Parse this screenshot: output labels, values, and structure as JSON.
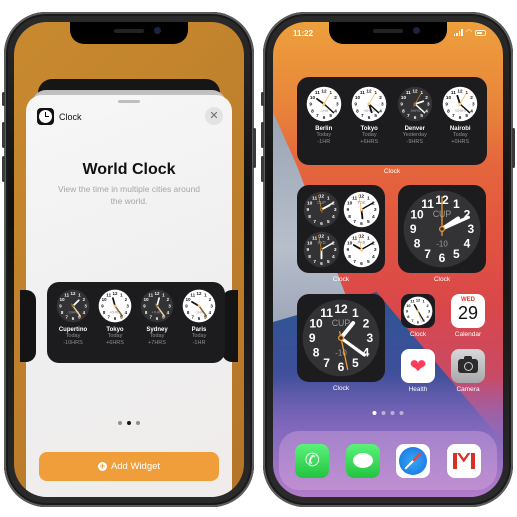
{
  "left_phone": {
    "sheet": {
      "app_name": "Clock",
      "close_icon": "✕",
      "title": "World Clock",
      "description": "View the time in multiple cities around the world.",
      "page_dots": {
        "count": 3,
        "active": 1
      },
      "add_button_label": "Add Widget",
      "add_button_icon": "+",
      "accent_color": "#f09e3a"
    },
    "preview_widget": {
      "cities": [
        {
          "name": "Cupertino",
          "day": "Today",
          "offset": "-10HRS",
          "face": "dark",
          "hour": 1.5,
          "minute": 24,
          "second": 24
        },
        {
          "name": "Tokyo",
          "day": "Today",
          "offset": "+6HRS",
          "face": "light",
          "hour": 11.5,
          "minute": 24,
          "second": 24
        },
        {
          "name": "Sydney",
          "day": "Today",
          "offset": "+7HRS",
          "face": "dark",
          "hour": 12.5,
          "minute": 24,
          "second": 24
        },
        {
          "name": "Paris",
          "day": "Today",
          "offset": "-1HR",
          "face": "light",
          "hour": 10,
          "minute": 24,
          "second": 24
        }
      ]
    }
  },
  "right_phone": {
    "status_bar": {
      "time": "11:22"
    },
    "world_widget": {
      "label": "Clock",
      "cities": [
        {
          "name": "Berlin",
          "day": "Today",
          "offset": "-1HR",
          "face": "light",
          "hour": 10.2,
          "minute": 22,
          "second": 5
        },
        {
          "name": "Tokyo",
          "day": "Today",
          "offset": "+6HRS",
          "face": "light",
          "hour": 5.4,
          "minute": 22,
          "second": 5
        },
        {
          "name": "Denver",
          "day": "Yesterday",
          "offset": "-9HRS",
          "face": "dark",
          "hour": 2.4,
          "minute": 22,
          "second": 5
        },
        {
          "name": "Nairobi",
          "day": "Today",
          "offset": "+0HRS",
          "face": "light",
          "hour": 11.4,
          "minute": 22,
          "second": 5
        }
      ]
    },
    "quad_widget": {
      "label": "Clock",
      "clocks": [
        {
          "abbr": "CUP",
          "face": "dark",
          "hour": 2.1,
          "minute": 10,
          "second": 58
        },
        {
          "abbr": "TOK",
          "face": "light",
          "hour": 5.8,
          "minute": 10,
          "second": 58
        },
        {
          "abbr": "SYD",
          "face": "dark",
          "hour": 6,
          "minute": 10,
          "second": 58
        },
        {
          "abbr": "PAR",
          "face": "light",
          "hour": 10,
          "minute": 10,
          "second": 58
        }
      ]
    },
    "single_widget_a": {
      "label": "Clock",
      "abbr": "CUP",
      "offset": "-10",
      "face": "dark",
      "hour": 1.3,
      "minute": 21,
      "second": 28
    },
    "single_widget_b": {
      "label": "Clock",
      "abbr": "CUP",
      "offset": "-10",
      "face": "dark",
      "hour": 1.9,
      "minute": 11,
      "second": 0
    },
    "apps": [
      {
        "name": "Clock"
      },
      {
        "name": "Calendar",
        "weekday": "WED",
        "day": "29"
      },
      {
        "name": "Health",
        "glyph": "❤"
      },
      {
        "name": "Camera"
      }
    ],
    "page_dots": {
      "count": 4,
      "active": 0
    },
    "dock": [
      {
        "name": "Phone",
        "glyph": "✆"
      },
      {
        "name": "Messages"
      },
      {
        "name": "Safari"
      },
      {
        "name": "Gmail"
      }
    ]
  }
}
